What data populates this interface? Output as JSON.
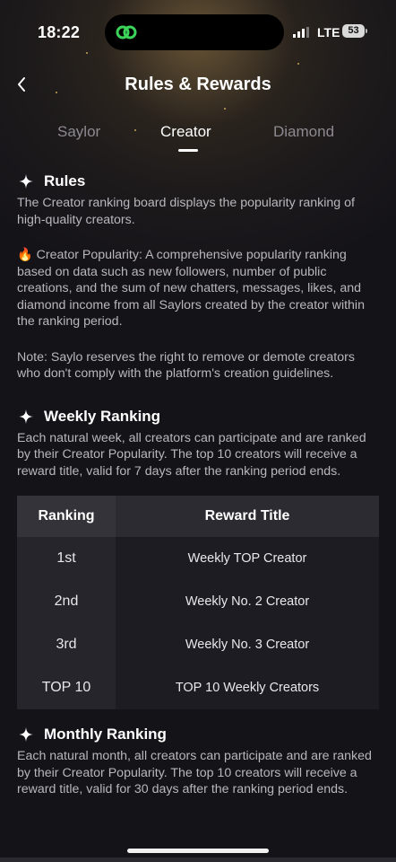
{
  "status_bar": {
    "time": "18:22",
    "network": "LTE",
    "battery": "53"
  },
  "header": {
    "title": "Rules & Rewards",
    "back_icon": "chevron-left-icon"
  },
  "tabs": [
    {
      "label": "Saylor",
      "active": false
    },
    {
      "label": "Creator",
      "active": true
    },
    {
      "label": "Diamond",
      "active": false
    }
  ],
  "rules": {
    "title": "Rules",
    "p1": "The Creator ranking board displays the popularity ranking of high-quality creators.",
    "p2_emoji": "🔥",
    "p2": "Creator Popularity: A comprehensive popularity ranking based on data such as new followers, number of public creations, and the sum of new chatters, messages, likes, and diamond income from all Saylors created by the creator within the ranking period.",
    "p3": "Note: Saylo reserves the right to remove or demote creators who don't comply with the platform's creation guidelines."
  },
  "weekly": {
    "title": "Weekly Ranking",
    "desc": "Each natural week, all creators can participate and are ranked by their Creator Popularity. The top 10 creators will receive a reward title, valid for 7 days after the ranking period ends.",
    "table_headers": [
      "Ranking",
      "Reward Title"
    ],
    "rows": [
      {
        "rank": "1st",
        "reward": "Weekly TOP Creator"
      },
      {
        "rank": "2nd",
        "reward": "Weekly No. 2 Creator"
      },
      {
        "rank": "3rd",
        "reward": "Weekly No. 3 Creator"
      },
      {
        "rank": "TOP 10",
        "reward": "TOP 10 Weekly Creators"
      }
    ]
  },
  "monthly": {
    "title": "Monthly Ranking",
    "desc": "Each natural month, all creators can participate and are ranked by their Creator Popularity. The top 10 creators will receive a reward title, valid for 30 days after the ranking period ends."
  },
  "colors": {
    "background": "#141318",
    "accent_glow": "#e9c36b",
    "text_muted": "#b9b7bd",
    "tab_inactive": "#8c8a90",
    "island_icon": "#3cd35a"
  }
}
